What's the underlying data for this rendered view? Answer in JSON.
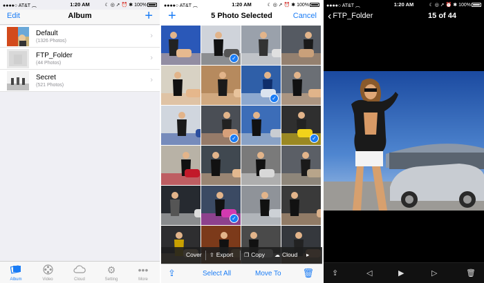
{
  "status": {
    "carrier": "AT&T",
    "time": "1:20 AM",
    "battery": "100%"
  },
  "albums_screen": {
    "edit_label": "Edit",
    "title": "Album",
    "add_label": "+",
    "albums": [
      {
        "name": "Default",
        "count": "(1326 Photos)"
      },
      {
        "name": "FTP_Folder",
        "count": "(44 Photos)"
      },
      {
        "name": "Secret",
        "count": "(521 Photos)"
      }
    ],
    "tabs": [
      {
        "label": "Album",
        "icon": "photos-icon"
      },
      {
        "label": "Video",
        "icon": "film-reel-icon"
      },
      {
        "label": "Cloud",
        "icon": "cloud-icon"
      },
      {
        "label": "Setting",
        "icon": "gear-icon"
      },
      {
        "label": "More",
        "icon": "more-icon"
      }
    ],
    "active_tab": "Album"
  },
  "select_screen": {
    "add_label": "+",
    "title": "5 Photo Selected",
    "cancel_label": "Cancel",
    "selected_cells": [
      1,
      6,
      9,
      11,
      17
    ],
    "actions": [
      {
        "label": "Cover",
        "icon": ""
      },
      {
        "label": "Export",
        "icon": "export-icon"
      },
      {
        "label": "Copy",
        "icon": "copy-icon"
      },
      {
        "label": "Cloud",
        "icon": "cloud-icon"
      }
    ],
    "bottom": {
      "select_all": "Select All",
      "move_to": "Move To"
    }
  },
  "viewer_screen": {
    "back_label": "FTP_Folder",
    "counter": "15 of 44"
  },
  "colors": {
    "accent": "#1a7cf5",
    "check": "#1a7cf5"
  }
}
